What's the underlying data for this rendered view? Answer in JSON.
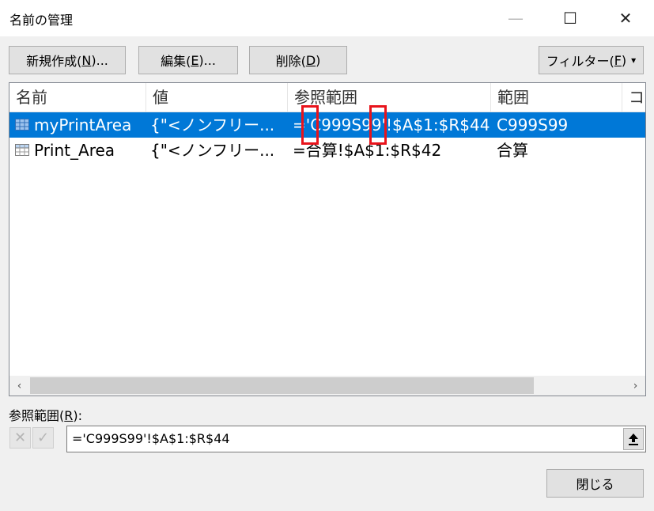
{
  "window": {
    "title": "名前の管理",
    "controls": {
      "minimize": "—",
      "maximize": "☐",
      "close": "✕"
    }
  },
  "toolbar": {
    "new_label_pre": "新規作成(",
    "new_label_key": "N",
    "new_label_post": ")...",
    "edit_label_pre": "編集(",
    "edit_label_key": "E",
    "edit_label_post": ")...",
    "delete_label_pre": "削除(",
    "delete_label_key": "D",
    "delete_label_post": ")",
    "filter_label_pre": "フィルター(",
    "filter_label_key": "F",
    "filter_label_post": ")",
    "filter_arrow": "▾"
  },
  "list": {
    "columns": [
      "名前",
      "値",
      "参照範囲",
      "範囲",
      "コ"
    ],
    "rows": [
      {
        "name": "myPrintArea",
        "value": "{\"<ノンフリー...",
        "refers_to": "='C999S99'!$A$1:$R$44",
        "scope": "C999S99",
        "selected": true
      },
      {
        "name": "Print_Area",
        "value": "{\"<ノンフリー...",
        "refers_to": "=合算!$A$1:$R$42",
        "scope": "合算",
        "selected": false
      }
    ]
  },
  "scrollbar": {
    "left_arrow": "‹",
    "right_arrow": "›"
  },
  "refers_to": {
    "label_pre": "参照範囲(",
    "label_key": "R",
    "label_post": "):",
    "cancel_icon": "✕",
    "confirm_icon": "✓",
    "value": "='C999S99'!$A$1:$R$44"
  },
  "footer": {
    "close_label": "閉じる"
  },
  "colors": {
    "selection": "#0078d7",
    "annotation": "#e8141c"
  }
}
